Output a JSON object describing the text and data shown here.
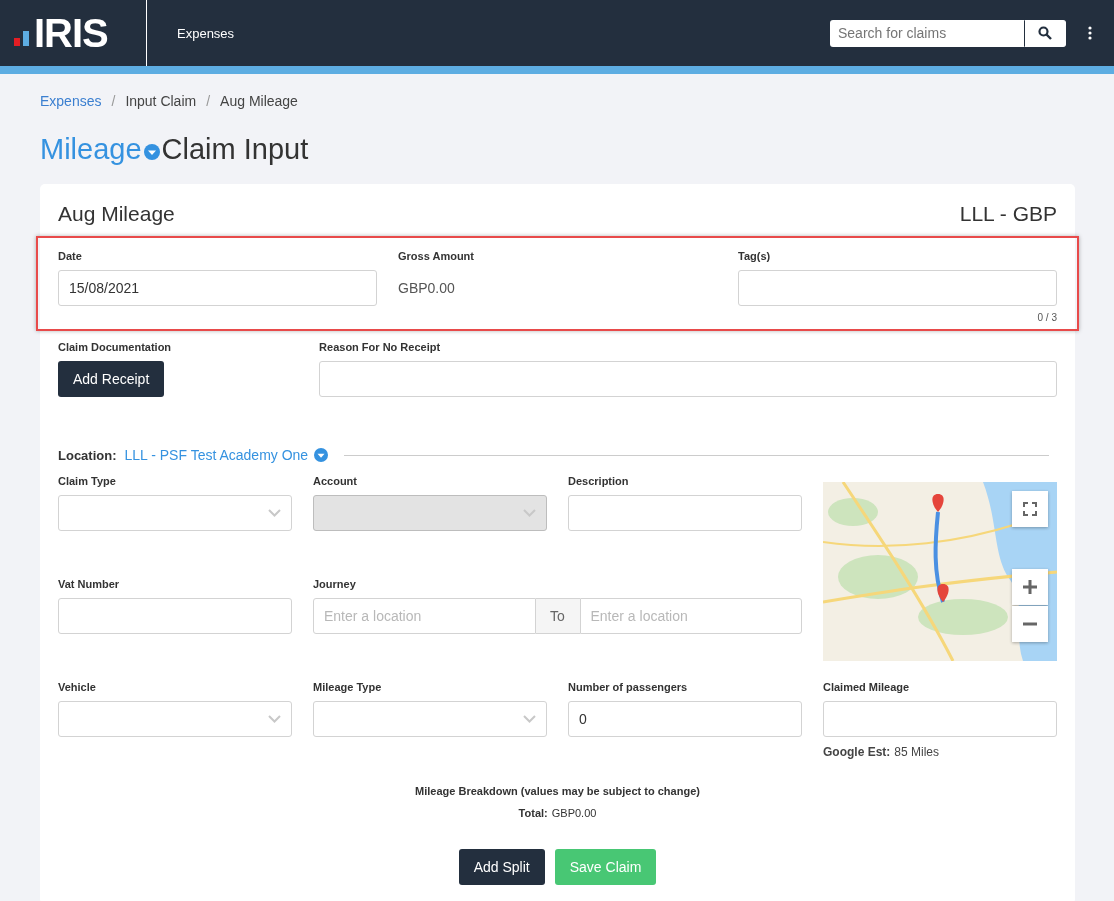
{
  "header": {
    "logo": "IRIS",
    "nav": "Expenses",
    "search": {
      "placeholder": "Search for claims"
    }
  },
  "breadcrumbs": [
    {
      "label": "Expenses",
      "link": true
    },
    {
      "separator": "/",
      "label": "Input Claim",
      "link": false
    },
    {
      "separator": "/",
      "label": "Aug Mileage",
      "link": false
    }
  ],
  "page_title": {
    "type": "Mileage",
    "rest": "Claim Input"
  },
  "claim": {
    "title": "Aug Mileage",
    "entity": "LLL - GBP",
    "summary": {
      "highlighted": true,
      "date": {
        "label": "Date",
        "value": "15/08/2021"
      },
      "gross": {
        "label": "Gross Amount",
        "value": "GBP0.00"
      },
      "tags": {
        "label": "Tag(s)",
        "count": "0 / 3"
      }
    },
    "documentation": {
      "label": "Claim Documentation",
      "button": "Add Receipt"
    },
    "no_receipt": {
      "label": "Reason For No Receipt"
    },
    "location": {
      "label": "Location:",
      "value": "LLL - PSF Test Academy One"
    },
    "fields": [
      {
        "kind": "select",
        "label": "Claim Type",
        "disabled": false
      },
      {
        "kind": "select",
        "label": "Account",
        "disabled": true
      },
      {
        "kind": "text",
        "label": "Description"
      },
      {
        "kind": "text",
        "label": "Vat Number"
      },
      {
        "kind": "journey",
        "label": "Journey",
        "from_placeholder": "Enter a location",
        "to": "To",
        "to_placeholder": "Enter a location"
      },
      {
        "kind": "select",
        "label": "Vehicle",
        "disabled": false
      },
      {
        "kind": "select",
        "label": "Mileage Type",
        "disabled": false
      },
      {
        "kind": "text",
        "label": "Number of passengers",
        "value": "0"
      }
    ],
    "claimed_mileage": {
      "label": "Claimed Mileage",
      "estimate_label": "Google Est:",
      "estimate": "85 Miles"
    },
    "breakdown": {
      "title": "Mileage Breakdown (values may be subject to change)",
      "total_label": "Total:",
      "total": "GBP0.00"
    },
    "buttons": [
      {
        "kind": "dark",
        "label": "Add Split"
      },
      {
        "kind": "success",
        "label": "Save Claim"
      }
    ]
  }
}
